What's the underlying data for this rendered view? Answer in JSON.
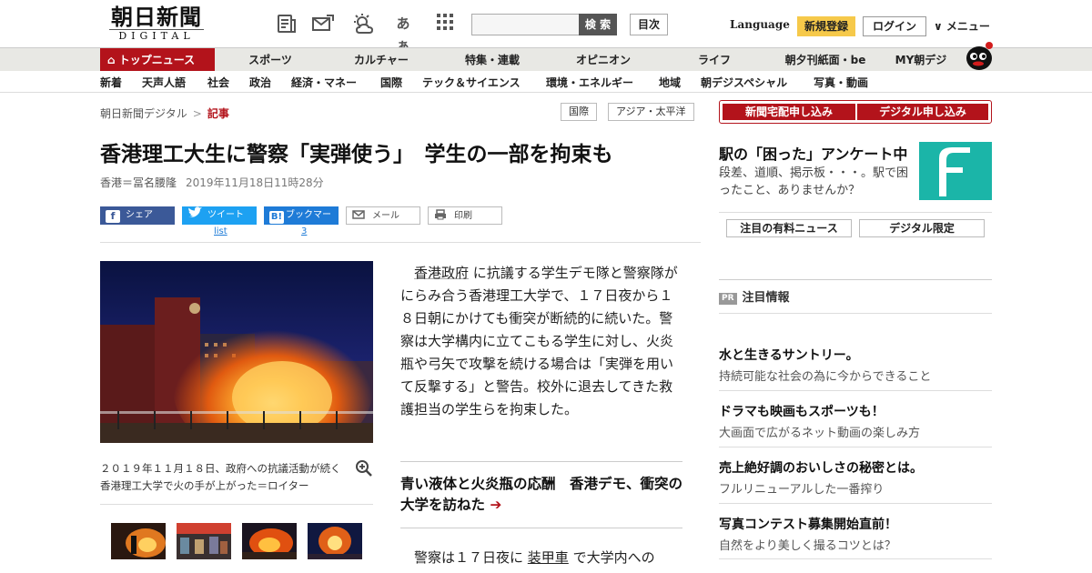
{
  "header": {
    "logo_jp": "朝日新聞",
    "logo_en": "DIGITAL",
    "search_button": "検 索",
    "contents_button": "目次",
    "language": "Language",
    "register": "新規登録",
    "login": "ログイン",
    "menu": "∨ メニュー",
    "tool_icons": [
      "newspaper-icon",
      "mail-icon",
      "weather-icon",
      "font-size-icon",
      "grid-icon"
    ],
    "font_size_label": "あぁ"
  },
  "nav": {
    "top_news": "トップニュース",
    "primary": [
      "スポーツ",
      "カルチャー",
      "特集・連載",
      "オピニオン",
      "ライフ",
      "朝夕刊紙面・be",
      "MY朝デジ"
    ],
    "secondary": [
      "新着",
      "天声人語",
      "社会",
      "政治",
      "経済・マネー",
      "国際",
      "テック＆サイエンス",
      "環境・エネルギー",
      "地域",
      "朝デジスペシャル",
      "写真・動画"
    ]
  },
  "breadcrumb": {
    "home": "朝日新聞デジタル",
    "sep": ">",
    "current": "記事",
    "tags": [
      "国際",
      "アジア・太平洋"
    ]
  },
  "article": {
    "title": "香港理工大生に警察「実弾使う」　学生の一部を拘束も",
    "author": "香港＝冨名腰隆",
    "date": "2019年11月18日11時28分",
    "share": {
      "facebook": "シェア",
      "twitter": "ツイート",
      "hatena": "ブックマーク",
      "mail": "メール",
      "print": "印刷",
      "twitter_count": "list",
      "hatena_count": "3"
    },
    "caption": "２０１９年１１月１８日、政府への抗議活動が続く香港理工大学で火の手が上がった＝ロイター",
    "body1_link": "香港政府",
    "body1_rest": " に抗議する学生デモ隊と警察隊がにらみ合う香港理工大学で、１７日夜から１８日朝にかけても衝突が断続的に続いた。警察は大学構内に立てこもる学生に対し、火炎瓶や弓矢で攻撃を続ける場合は「実弾を用いて反撃する」と警告。校外に退去してきた救護担当の学生らを拘束した。",
    "related": "青い液体と火炎瓶の応酬　香港デモ、衝突の大学を訪ねた",
    "related_arrow": "➔",
    "body2_pre": "警察は１７日夜に ",
    "body2_link": "装甲車",
    "body2_post": " で大学内への"
  },
  "sidebar": {
    "subscribe_paper": "新聞宅配申し込み",
    "subscribe_digital": "デジタル申し込み",
    "survey_title": "駅の「困った」アンケート中",
    "survey_text": "段差、道順、掲示板・・・。駅で困ったこと、ありませんか？",
    "tab_paid": "注目の有料ニュース",
    "tab_digital": "デジタル限定",
    "pr_badge": "PR",
    "pr_heading": "注目情報",
    "ads": [
      {
        "title": "水と生きるサントリー。",
        "sub": "持続可能な社会の為に今からできること"
      },
      {
        "title": "ドラマも映画もスポーツも！",
        "sub": "大画面で広がるネット動画の楽しみ方"
      },
      {
        "title": "売上絶好調のおいしさの秘密とは。",
        "sub": "フルリニューアルした一番搾り"
      },
      {
        "title": "写真コンテスト募集開始直前！",
        "sub": "自然をより美しく撮るコツとは？"
      }
    ]
  },
  "colors": {
    "brand_red": "#b3131b",
    "facebook": "#3b5998",
    "twitter": "#1da1f2",
    "hatena": "#1e7bd7",
    "register_yellow": "#f6c94a",
    "survey_teal": "#1bb5a8"
  }
}
